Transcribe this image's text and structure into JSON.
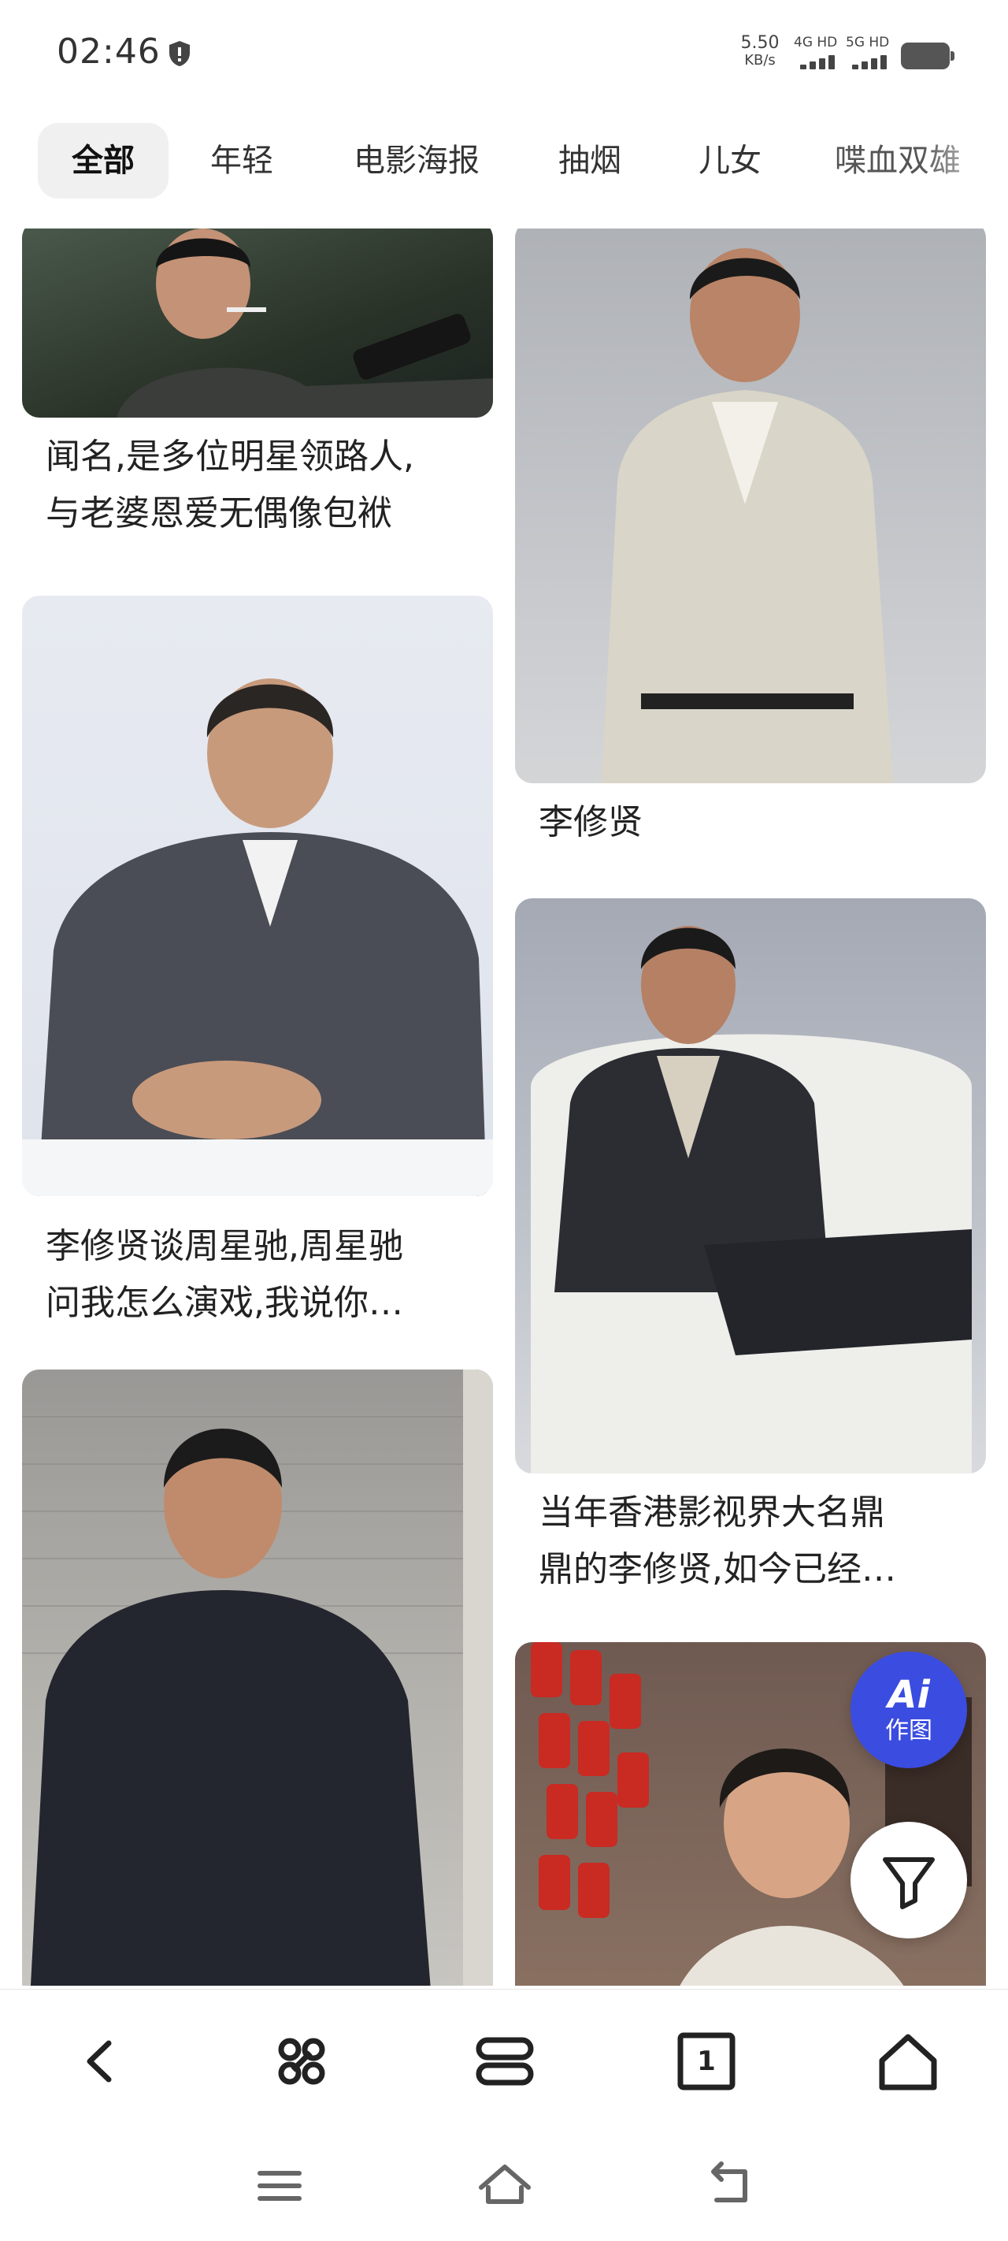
{
  "status_bar": {
    "time": "02:46",
    "net_speed_value": "5.50",
    "net_speed_unit": "KB/s",
    "sim1_label": "4G HD",
    "sim2_label": "5G HD"
  },
  "tabs": [
    {
      "label": "全部",
      "active": true
    },
    {
      "label": "年轻",
      "active": false
    },
    {
      "label": "电影海报",
      "active": false
    },
    {
      "label": "抽烟",
      "active": false
    },
    {
      "label": "儿女",
      "active": false
    },
    {
      "label": "喋血双雄",
      "active": false
    }
  ],
  "cards": [
    {
      "caption_lines": [
        "闻名,是多位明星领路人,",
        "与老婆恩爱无偶像包袱"
      ]
    },
    {
      "caption_lines": [
        "李修贤"
      ]
    },
    {
      "caption_lines": [
        "李修贤谈周星驰,周星驰",
        "问我怎么演戏,我说你…"
      ]
    },
    {
      "caption_lines": [
        "当年香港影视界大名鼎",
        "鼎的李修贤,如今已经…"
      ]
    },
    {
      "caption_lines": []
    },
    {
      "caption_lines": []
    }
  ],
  "fab": {
    "ai_text": "Ai",
    "ai_label": "作图"
  },
  "colors": {
    "accent": "#3b4ce0",
    "tab_active_bg": "#f0f0f0"
  },
  "bottom_bar": {
    "tab_count": "1"
  }
}
